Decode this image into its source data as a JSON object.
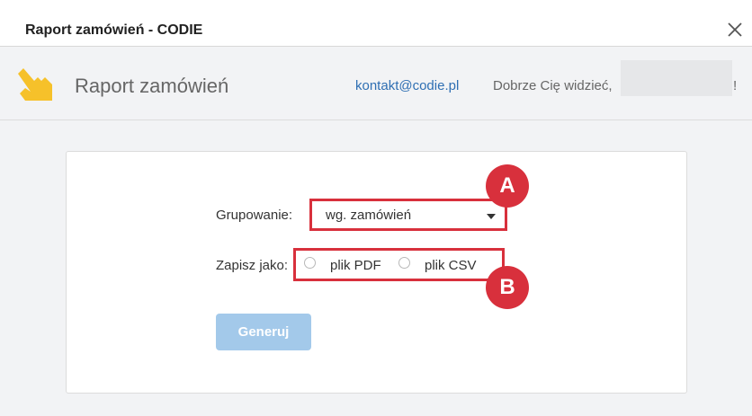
{
  "window": {
    "title": "Raport zamówień - CODIE",
    "close_icon": "close-icon"
  },
  "header": {
    "logo_icon": "codie-hand-logo-icon",
    "title": "Raport zamówień",
    "contact_email": "kontakt@codie.pl",
    "greeting": "Dobrze Cię widzieć,",
    "greeting_end": "!"
  },
  "form": {
    "grouping_label": "Grupowanie:",
    "grouping_value": "wg. zamówień",
    "save_as_label": "Zapisz jako:",
    "options": [
      {
        "label": "plik PDF",
        "selected": false
      },
      {
        "label": "plik CSV",
        "selected": false
      }
    ],
    "generate_label": "Generuj"
  },
  "annotations": {
    "a": "A",
    "b": "B"
  },
  "colors": {
    "accent_red": "#d8303c",
    "button_blue": "#a3c9ea",
    "link_blue": "#2f6fb3",
    "logo_yellow": "#f6c12a"
  }
}
